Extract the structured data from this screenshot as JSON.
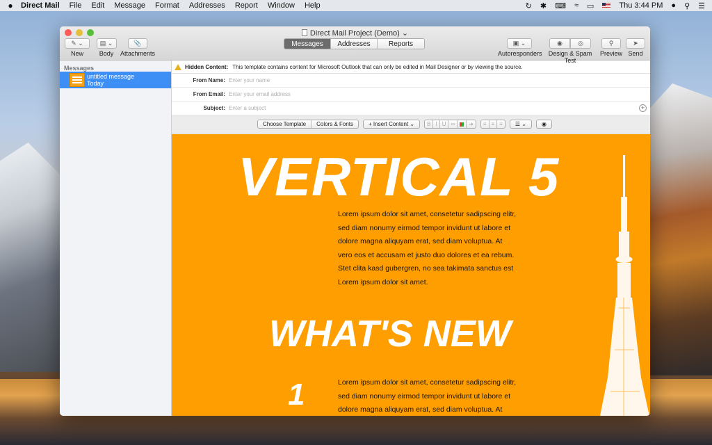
{
  "menubar": {
    "app": "Direct Mail",
    "items": [
      "File",
      "Edit",
      "Message",
      "Format",
      "Addresses",
      "Report",
      "Window",
      "Help"
    ],
    "clock": "Thu 3:44 PM"
  },
  "window": {
    "title": "Direct Mail Project (Demo)",
    "toolbar": {
      "new": "New",
      "body": "Body",
      "attachments": "Attachments",
      "tabs": [
        "Messages",
        "Addresses",
        "Reports"
      ],
      "autoresponders": "Autoresponders",
      "design_spam": "Design & Spam Test",
      "preview": "Preview",
      "send": "Send"
    }
  },
  "sidebar": {
    "header": "Messages",
    "items": [
      {
        "title": "untitled message",
        "date": "Today"
      }
    ]
  },
  "composer": {
    "hidden_label": "Hidden Content:",
    "hidden_text": "This template contains content for Microsoft Outlook that can only be edited in Mail Designer or by viewing the source.",
    "from_name_label": "From Name:",
    "from_name_placeholder": "Enter your name",
    "from_email_label": "From Email:",
    "from_email_placeholder": "Enter your email address",
    "subject_label": "Subject:",
    "subject_placeholder": "Enter a subject",
    "toolbar": {
      "choose_template": "Choose Template",
      "colors_fonts": "Colors & Fonts",
      "insert_content": "+ Insert Content ⌄",
      "bold": "B",
      "italic": "I",
      "underline": "U"
    }
  },
  "email": {
    "headline": "VERTICAL 5",
    "paragraph1_lines": [
      "Lorem ipsum dolor sit amet, consetetur sadipscing elitr,",
      "sed diam nonumy eirmod tempor invidunt ut labore et",
      "dolore magna aliquyam erat, sed diam voluptua. At",
      "vero eos et accusam et justo duo dolores et ea rebum.",
      "Stet clita kasd gubergren, no sea takimata sanctus est",
      "Lorem ipsum dolor sit amet."
    ],
    "section_title": "WHAT'S NEW",
    "item_number": "1",
    "paragraph2_lines": [
      "Lorem ipsum dolor sit amet, consetetur sadipscing elitr,",
      "sed diam nonumy eirmod tempor invidunt ut labore et",
      "dolore magna aliquyam erat, sed diam voluptua. At"
    ],
    "background_color": "#ff9e00"
  }
}
